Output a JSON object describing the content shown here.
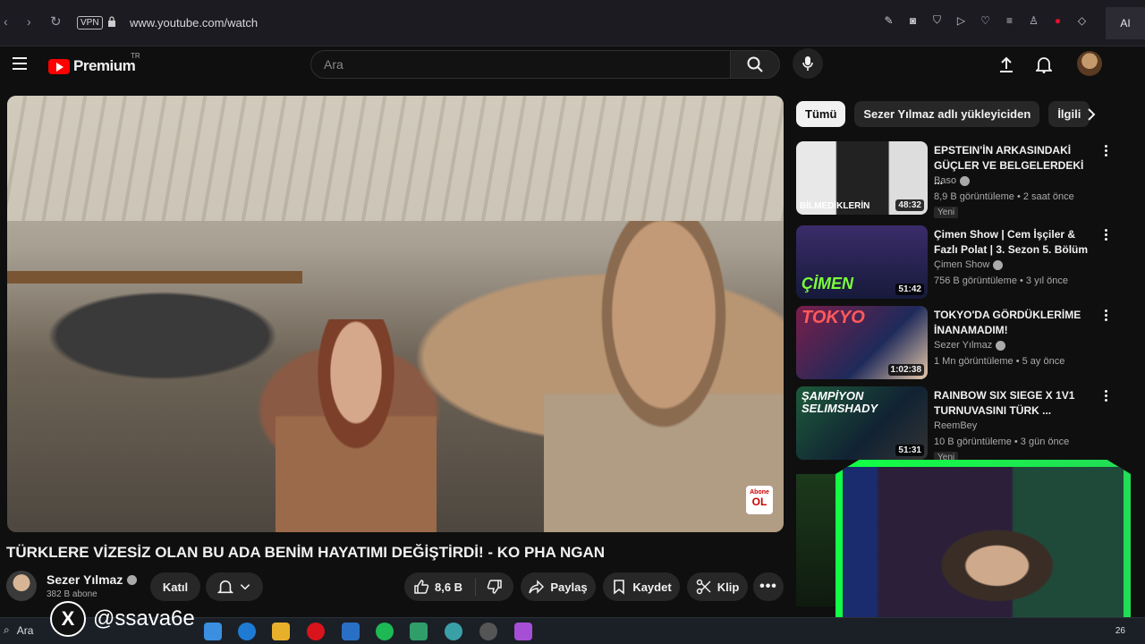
{
  "browser": {
    "vpn_label": "VPN",
    "url": "www.youtube.com/watch",
    "ai_label": "AI"
  },
  "header": {
    "logo_text": "Premium",
    "logo_region": "TR",
    "search_placeholder": "Ara"
  },
  "video": {
    "title": "TÜRKLERE VİZESİZ OLAN BU ADA BENİM HAYATIMI DEĞİŞTİRDİ! - KO PHA NGAN",
    "channel_name": "Sezer Yılmaz",
    "subscribers": "382 B abone",
    "abone_top": "Abone",
    "abone_bottom": "OL"
  },
  "actions": {
    "join": "Katıl",
    "likes": "8,6 B",
    "share": "Paylaş",
    "save": "Kaydet",
    "clip": "Klip"
  },
  "chips": [
    "Tümü",
    "Sezer Yılmaz adlı yükleyiciden",
    "İlgili"
  ],
  "recommendations": [
    {
      "title": "EPSTEIN'İN ARKASINDAKİ GÜÇLER VE BELGELERDEKİ ...",
      "channel": "Baso",
      "meta": "8,9 B görüntüleme • 2 saat önce",
      "duration": "48:32",
      "badge": "Yeni",
      "thumb_text": "BİLMEDİKLERİN"
    },
    {
      "title": "Çimen Show | Cem İşçiler & Fazlı Polat | 3. Sezon 5. Bölüm",
      "channel": "Çimen Show",
      "meta": "756 B görüntüleme • 3 yıl önce",
      "duration": "51:42",
      "thumb_text": "ÇİMEN"
    },
    {
      "title": "TOKYO'DA GÖRDÜKLERİME İNANAMADIM!",
      "channel": "Sezer Yılmaz",
      "meta": "1 Mn görüntüleme • 5 ay önce",
      "duration": "1:02:38",
      "thumb_text": "TOKYO"
    },
    {
      "title": "RAINBOW SIX SIEGE X 1V1 TURNUVASINI TÜRK ...",
      "channel": "ReemBey",
      "meta": "10 B görüntüleme • 3 gün önce",
      "duration": "51:31",
      "badge": "Yeni",
      "thumb_text": "ŞAMPİYON SELIMSHADY"
    }
  ],
  "watermark": {
    "x_letter": "X",
    "handle": "@ssava6e"
  },
  "taskbar": {
    "search_label": "Ara",
    "tray_number": "26"
  },
  "colors": {
    "youtube_red": "#ff0000",
    "background": "#0f0f0f",
    "overlay_green": "#11ff44"
  }
}
